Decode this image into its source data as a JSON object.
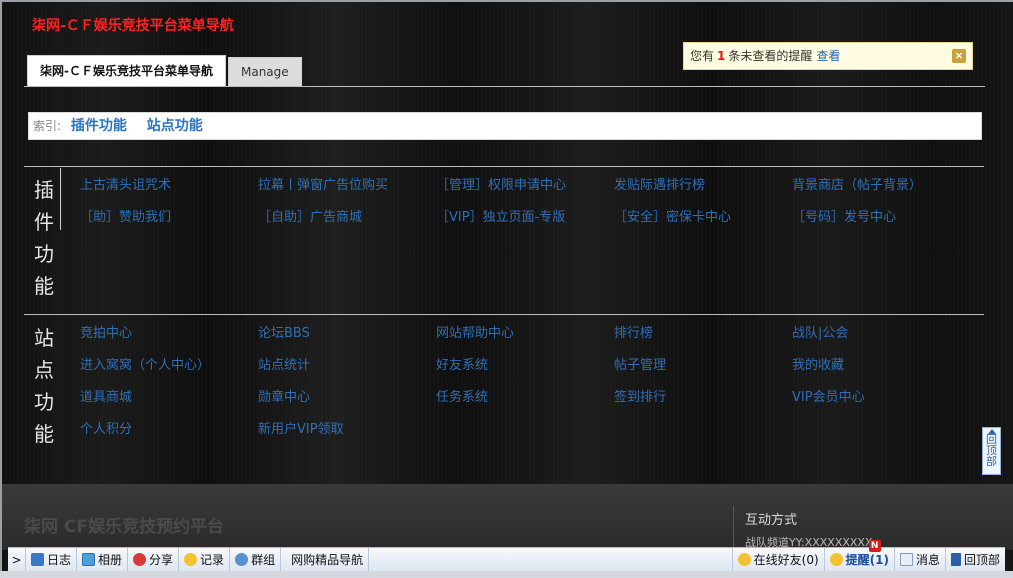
{
  "header": {
    "site_title": "柒网-ＣＦ娱乐竞技平台菜单导航"
  },
  "tabs": [
    {
      "label": "柒网-ＣＦ娱乐竞技平台菜单导航"
    },
    {
      "label": "Manage"
    }
  ],
  "notice": {
    "prefix": "您有",
    "count": "1",
    "suffix": "条未查看的提醒",
    "link": "查看",
    "close": "×"
  },
  "index": {
    "label": "索引:",
    "links": [
      {
        "label": "插件功能"
      },
      {
        "label": "站点功能"
      }
    ]
  },
  "sections": [
    {
      "side_label": [
        "插",
        "件",
        "功",
        "能"
      ],
      "rows": [
        [
          "上古清头诅咒术",
          "拉幕丨弹窗广告位购买",
          "［管理］权限申请中心",
          "发贴际遇排行榜",
          "背景商店（帖子背景）"
        ],
        [
          "［助］赞助我们",
          "［自助］广告商城",
          "［VIP］独立页面-专版",
          "［安全］密保卡中心",
          "［号码］发号中心"
        ]
      ]
    },
    {
      "side_label": [
        "站",
        "点",
        "功",
        "能"
      ],
      "rows": [
        [
          "竞拍中心",
          "论坛BBS",
          "网站帮助中心",
          "排行榜",
          "战队|公会"
        ],
        [
          "进入窝窝（个人中心）",
          "站点统计",
          "好友系统",
          "帖子管理",
          "我的收藏"
        ],
        [
          "道具商城",
          "勋章中心",
          "任务系统",
          "签到排行",
          "VIP会员中心"
        ],
        [
          "个人积分",
          "新用户VIP领取"
        ]
      ]
    }
  ],
  "footer": {
    "brand": "柒网 CF娱乐竞技预约平台",
    "contact_title": "互动方式",
    "contact_line": "战队频道YY:XXXXXXXXX"
  },
  "back_to_top": "回顶部",
  "toolbar": {
    "toggle": ">",
    "items": [
      "日志",
      "相册",
      "分享",
      "记录",
      "群组",
      "网购精品导航"
    ],
    "online_friends": "在线好友(0)",
    "remind": "提醒(1)",
    "remind_badge": "N",
    "message": "消息",
    "back_top": "回顶部"
  }
}
